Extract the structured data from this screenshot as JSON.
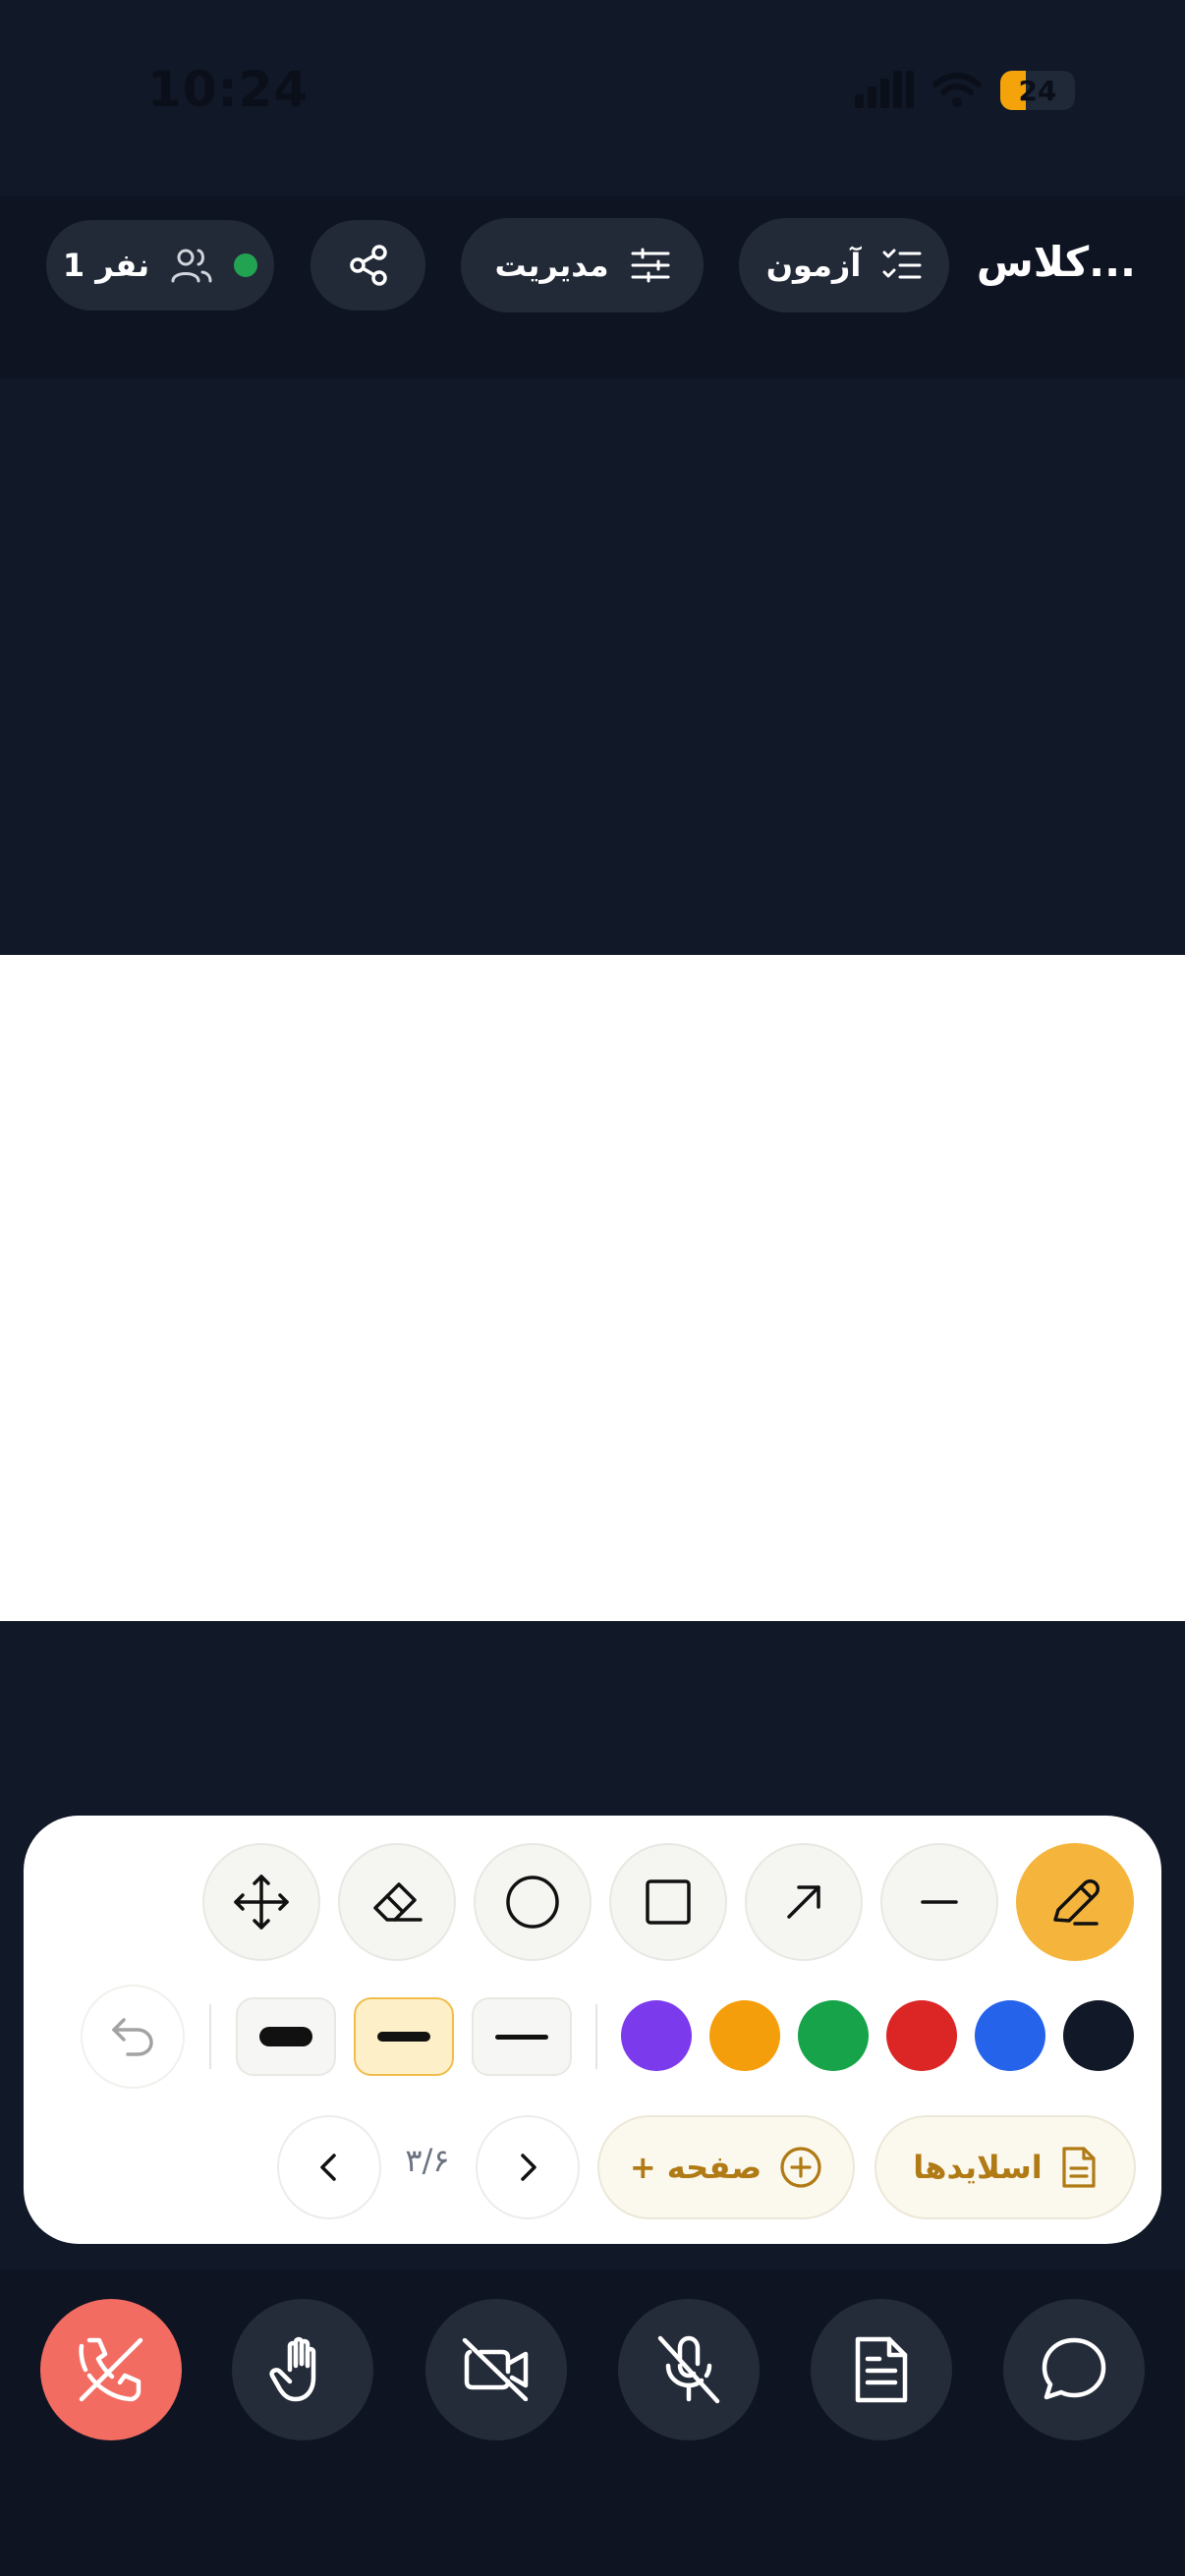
{
  "status_bar": {
    "time": "10:24",
    "battery": "24"
  },
  "header": {
    "class_title": "کلاس...",
    "exam_label": "آزمون",
    "manage_label": "مدیریت",
    "participants": "1 نفر"
  },
  "toolbar": {
    "tools": [
      "pen",
      "line",
      "arrow",
      "rectangle",
      "circle",
      "eraser",
      "move"
    ],
    "active_tool": "pen",
    "colors": [
      "#111827",
      "#2563eb",
      "#dc2626",
      "#16a34a",
      "#f59e0b",
      "#7c3aed"
    ],
    "stroke_widths": [
      "thin",
      "medium",
      "thick"
    ],
    "active_stroke": "medium",
    "slides_label": "اسلایدها",
    "add_page_label": "+ صفحه",
    "page_indicator": "۳/۶"
  },
  "bottom_bar": {
    "buttons": [
      "chat-icon",
      "document-icon",
      "mic-off-icon",
      "camera-off-icon",
      "raise-hand-icon",
      "hang-up-icon"
    ]
  },
  "accent_colors": {
    "primary": "#f5b53d",
    "hangup": "#f26c62",
    "online": "#22a351",
    "text_accent": "#b07a14"
  }
}
